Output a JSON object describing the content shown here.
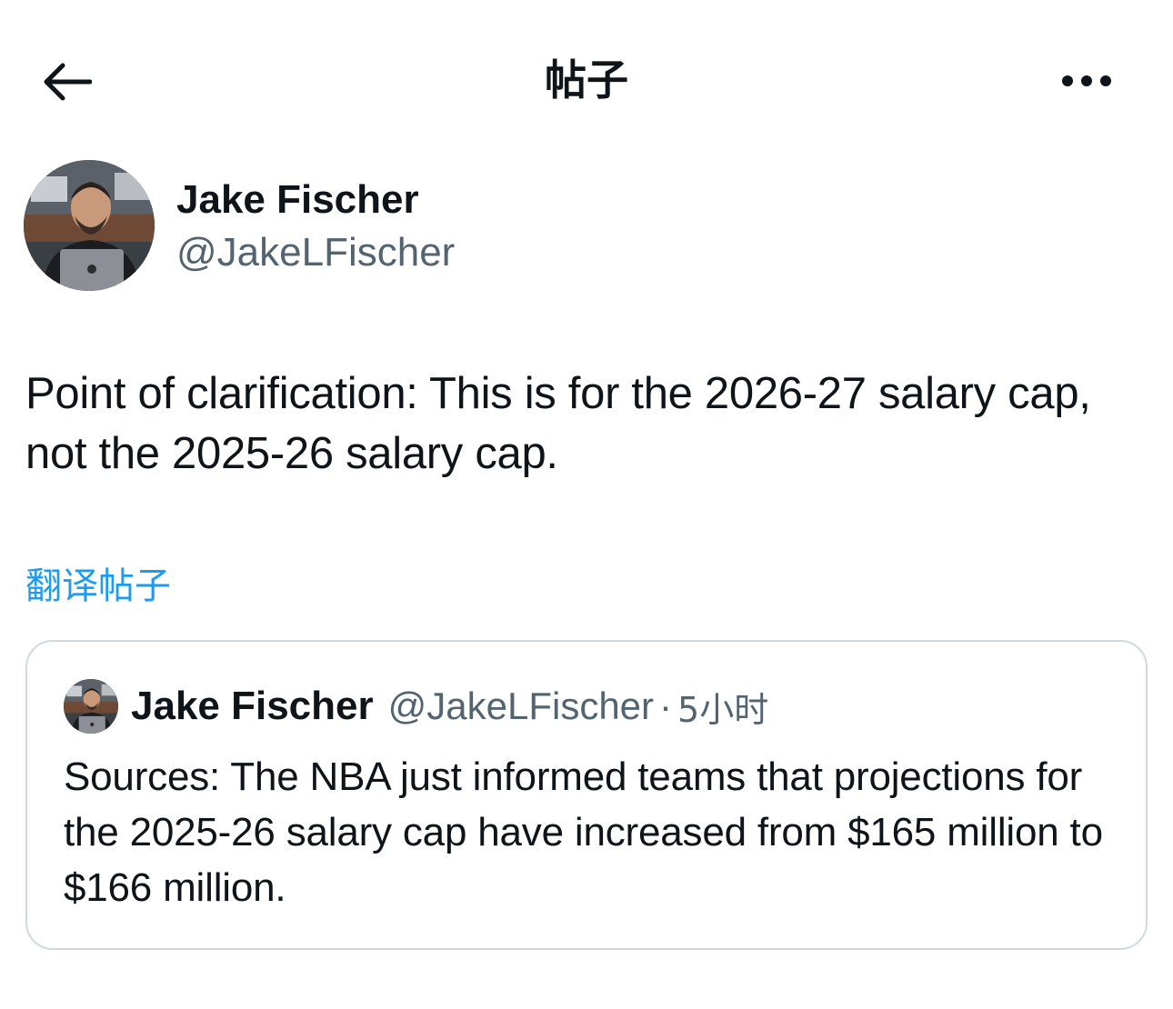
{
  "header": {
    "title": "帖子",
    "back_icon": "arrow-left-icon",
    "more_icon": "ellipsis-icon"
  },
  "post": {
    "author_name": "Jake Fischer",
    "author_handle": "@JakeLFischer",
    "text": "Point of clarification: This is for the 2026-27 salary cap, not the 2025-26 salary cap.",
    "translate_label": "翻译帖子"
  },
  "quoted_post": {
    "author_name": "Jake Fischer",
    "author_handle": "@JakeLFischer",
    "separator": "·",
    "time": "5小时",
    "text": "Sources: The NBA just informed teams that projections for the 2025-26 salary cap have increased from $165 million to $166 million."
  },
  "colors": {
    "text_primary": "#0f1419",
    "text_secondary": "#536471",
    "link": "#1d9bf0",
    "border": "#cfd9de"
  }
}
